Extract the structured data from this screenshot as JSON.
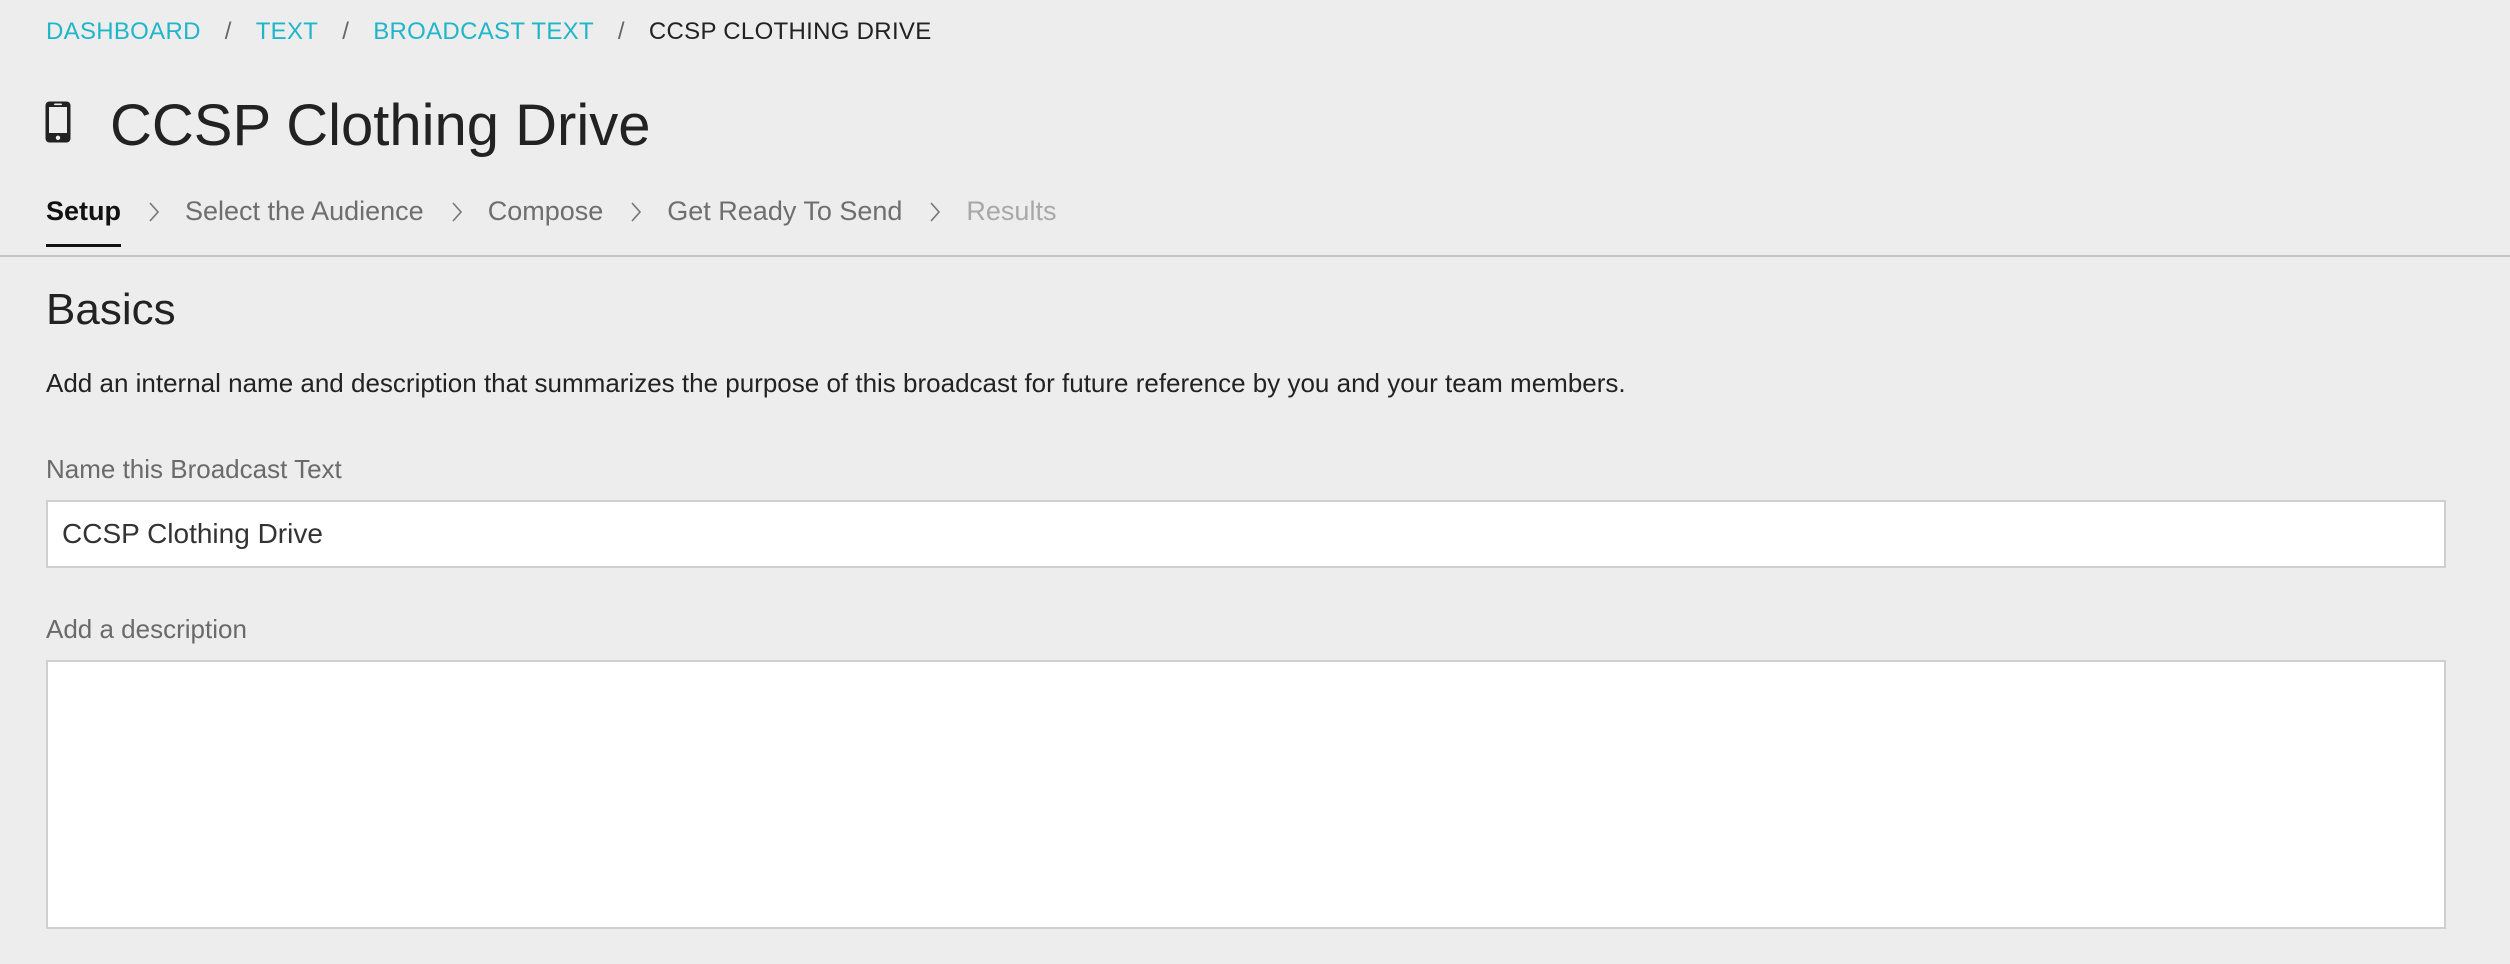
{
  "breadcrumb": {
    "items": [
      {
        "label": "DASHBOARD"
      },
      {
        "label": "TEXT"
      },
      {
        "label": "BROADCAST TEXT"
      }
    ],
    "separator": "/",
    "current": "CCSP CLOTHING DRIVE"
  },
  "header": {
    "icon": "mobile-phone-icon",
    "title": "CCSP Clothing Drive"
  },
  "steps": {
    "items": [
      {
        "label": "Setup",
        "state": "active"
      },
      {
        "label": "Select the Audience",
        "state": "enabled"
      },
      {
        "label": "Compose",
        "state": "enabled"
      },
      {
        "label": "Get Ready To Send",
        "state": "enabled"
      },
      {
        "label": "Results",
        "state": "disabled"
      }
    ],
    "separator_icon": "chevron-right-icon"
  },
  "basics": {
    "heading": "Basics",
    "description": "Add an internal name and description that summarizes the purpose of this broadcast for future reference by you and your team members.",
    "name_field": {
      "label": "Name this Broadcast Text",
      "value": "CCSP Clothing Drive"
    },
    "description_field": {
      "label": "Add a description",
      "value": ""
    }
  },
  "colors": {
    "link": "#1fb6c9",
    "background": "#ededed",
    "text": "#212121",
    "muted": "#6e6e6e",
    "disabled": "#a8a8a8"
  }
}
